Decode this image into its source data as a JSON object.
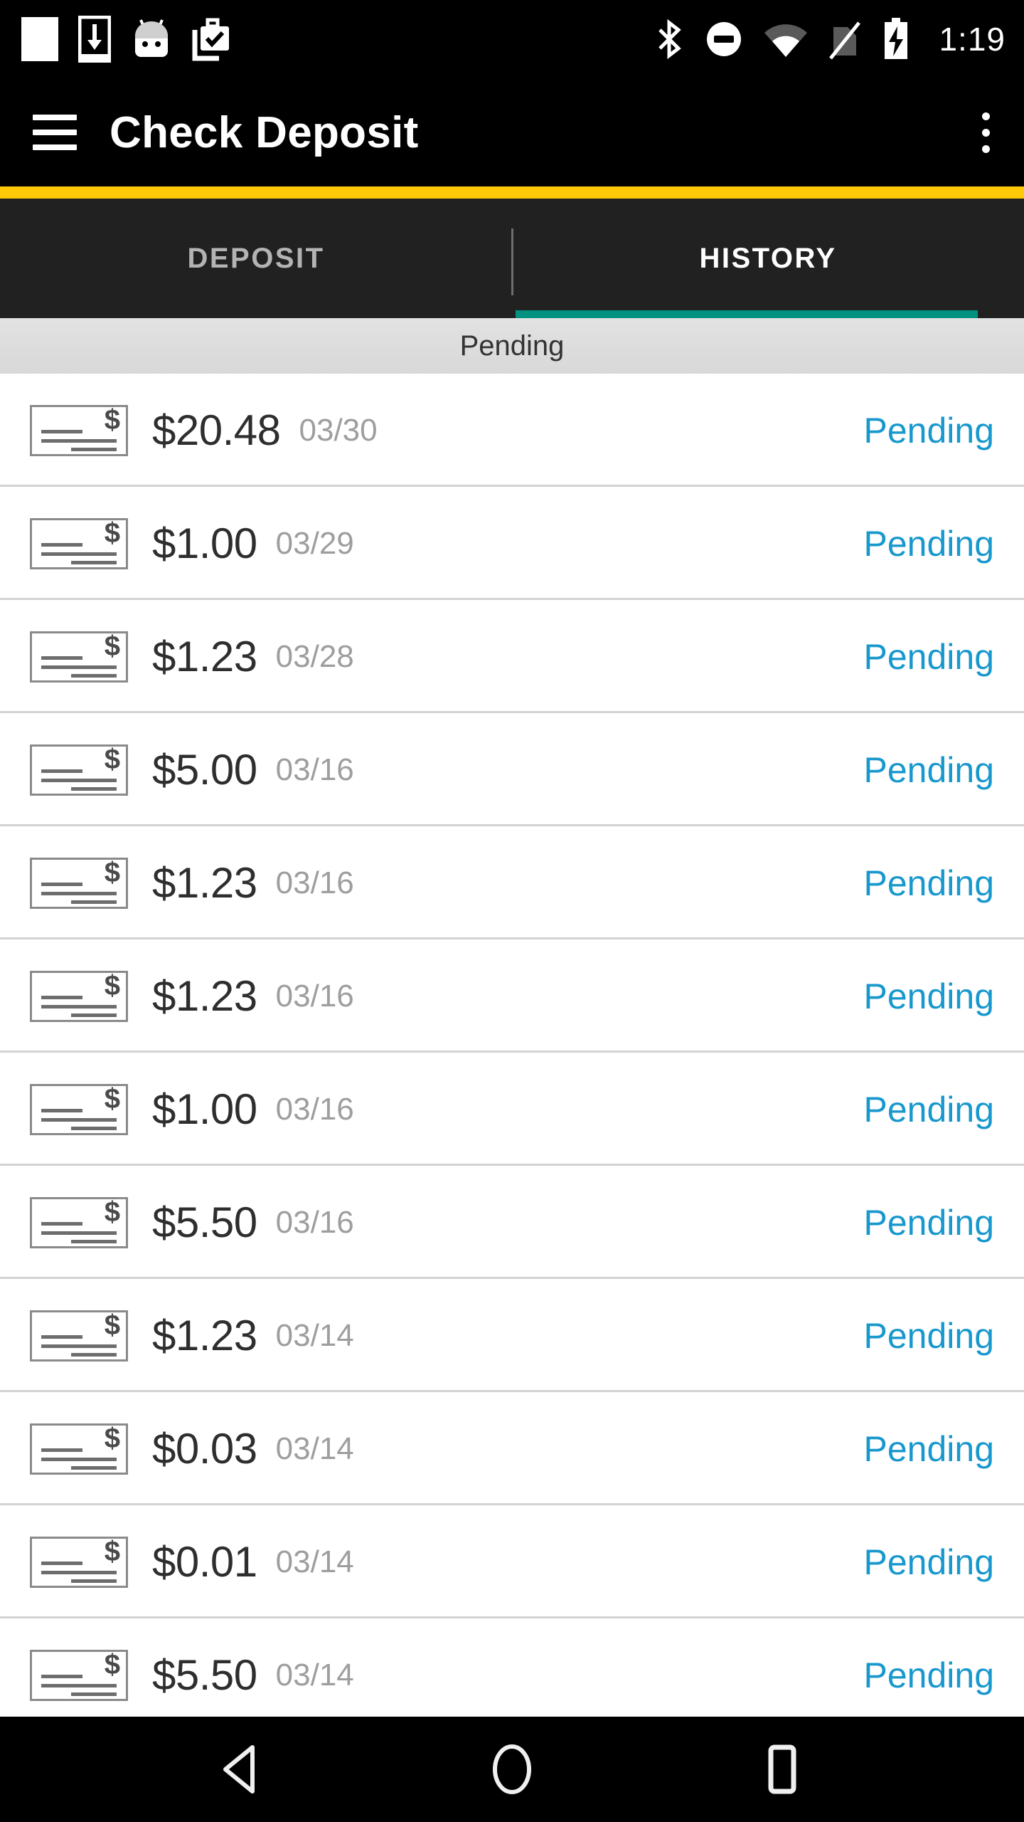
{
  "status_bar": {
    "time": "1:19",
    "left_icons": [
      "blank-notification-icon",
      "download-to-phone-icon",
      "android-robot-icon",
      "work-briefcase-check-icon"
    ],
    "right_icons": [
      "bluetooth-icon",
      "do-not-disturb-icon",
      "wifi-icon",
      "no-sim-icon",
      "battery-charging-icon"
    ]
  },
  "app_bar": {
    "menu_icon": "hamburger-menu-icon",
    "title": "Check Deposit",
    "overflow_icon": "more-vertical-icon",
    "background": "#000000",
    "accent_color": "#ffc907"
  },
  "tabs": {
    "items": [
      {
        "label": "DEPOSIT",
        "active": false
      },
      {
        "label": "HISTORY",
        "active": true
      }
    ],
    "indicator_color": "#00917f",
    "bar_background": "#212121"
  },
  "section": {
    "header": "Pending"
  },
  "list": {
    "icon_name": "check-icon",
    "status_color": "#1898cd",
    "rows": [
      {
        "amount": "$20.48",
        "date": "03/30",
        "status": "Pending"
      },
      {
        "amount": "$1.00",
        "date": "03/29",
        "status": "Pending"
      },
      {
        "amount": "$1.23",
        "date": "03/28",
        "status": "Pending"
      },
      {
        "amount": "$5.00",
        "date": "03/16",
        "status": "Pending"
      },
      {
        "amount": "$1.23",
        "date": "03/16",
        "status": "Pending"
      },
      {
        "amount": "$1.23",
        "date": "03/16",
        "status": "Pending"
      },
      {
        "amount": "$1.00",
        "date": "03/16",
        "status": "Pending"
      },
      {
        "amount": "$5.50",
        "date": "03/16",
        "status": "Pending"
      },
      {
        "amount": "$1.23",
        "date": "03/14",
        "status": "Pending"
      },
      {
        "amount": "$0.03",
        "date": "03/14",
        "status": "Pending"
      },
      {
        "amount": "$0.01",
        "date": "03/14",
        "status": "Pending"
      },
      {
        "amount": "$5.50",
        "date": "03/14",
        "status": "Pending"
      }
    ]
  },
  "nav_bar": {
    "buttons": [
      {
        "name": "back-button",
        "icon": "triangle-back-icon"
      },
      {
        "name": "home-button",
        "icon": "circle-home-icon"
      },
      {
        "name": "recents-button",
        "icon": "square-recents-icon"
      }
    ]
  }
}
